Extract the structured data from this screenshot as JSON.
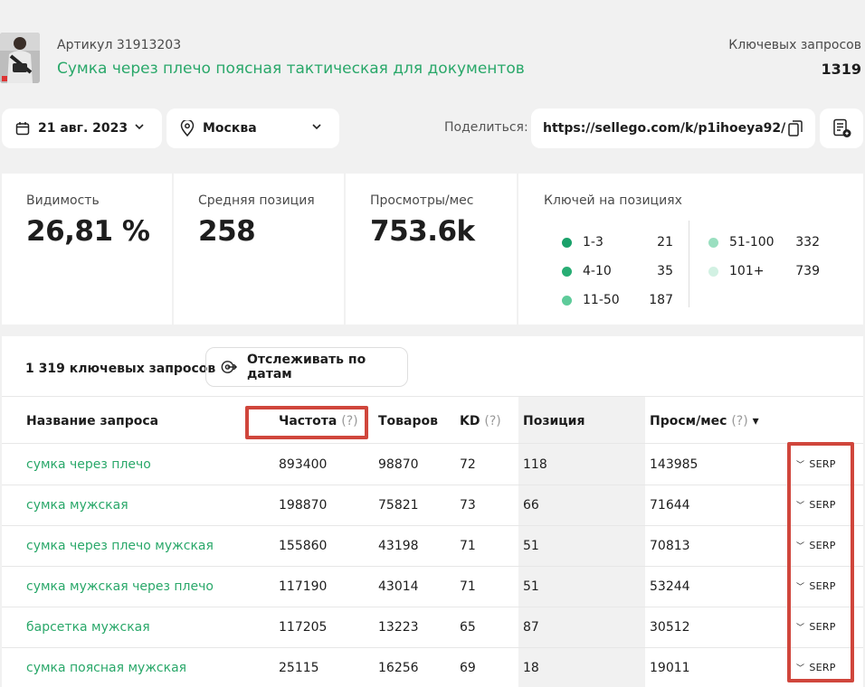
{
  "product": {
    "article": "Артикул 31913203",
    "title": "Сумка через плечо поясная тактическая для документов",
    "keywords_label": "Ключевых запросов",
    "keywords_count": "1319",
    "thumb_colors": [
      "#9a9a9a",
      "#2c2c2c",
      "#d9d9d9"
    ]
  },
  "controls": {
    "date": "21 авг. 2023",
    "city": "Москва",
    "share_label": "Поделиться:",
    "share_url": "https://sellego.com/k/p1ihoeya92/"
  },
  "stats": {
    "visibility_label": "Видимость",
    "visibility_value": "26,81 %",
    "avg_position_label": "Средняя позиция",
    "avg_position_value": "258",
    "views_label": "Просмотры/мес",
    "views_value": "753.6k",
    "positions_label": "Ключей на позициях",
    "kd_legend": [
      {
        "range": "1-3",
        "count": "21",
        "color": "#1aa16a"
      },
      {
        "range": "4-10",
        "count": "35",
        "color": "#28ad74"
      },
      {
        "range": "11-50",
        "count": "187",
        "color": "#5ecb9a"
      },
      {
        "range": "51-100",
        "count": "332",
        "color": "#9adfc0"
      },
      {
        "range": "101+",
        "count": "739",
        "color": "#d2f1e3"
      }
    ]
  },
  "table": {
    "total": "1 319 ключевых запросов",
    "track_label": "Отслеживать по датам",
    "headers": {
      "name": "Название запроса",
      "freq": "Частота",
      "freq_q": "(?)",
      "goods": "Товаров",
      "kd": "KD",
      "kd_q": "(?)",
      "position": "Позиция",
      "views": "Просм/мес",
      "views_q": "(?)",
      "sort": "▾"
    },
    "serp_label": "SERP",
    "rows": [
      {
        "name": "сумка через плечо",
        "freq": "893400",
        "goods": "98870",
        "kd": "72",
        "position": "118",
        "views": "143985"
      },
      {
        "name": "сумка мужская",
        "freq": "198870",
        "goods": "75821",
        "kd": "73",
        "position": "66",
        "views": "71644"
      },
      {
        "name": "сумка через плечо мужская",
        "freq": "155860",
        "goods": "43198",
        "kd": "71",
        "position": "51",
        "views": "70813"
      },
      {
        "name": "сумка мужская через плечо",
        "freq": "117190",
        "goods": "43014",
        "kd": "71",
        "position": "51",
        "views": "53244"
      },
      {
        "name": "барсетка мужская",
        "freq": "117205",
        "goods": "13223",
        "kd": "65",
        "position": "87",
        "views": "30512"
      },
      {
        "name": "сумка поясная мужская",
        "freq": "25115",
        "goods": "16256",
        "kd": "69",
        "position": "18",
        "views": "19011"
      }
    ]
  }
}
